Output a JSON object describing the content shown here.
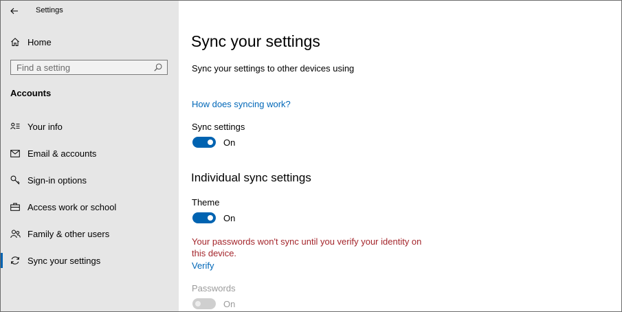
{
  "window": {
    "title": "Settings"
  },
  "sidebar": {
    "home_label": "Home",
    "search": {
      "placeholder": "Find a setting"
    },
    "section_heading": "Accounts",
    "items": [
      {
        "label": "Your info",
        "icon": "person-card-icon"
      },
      {
        "label": "Email & accounts",
        "icon": "mail-icon"
      },
      {
        "label": "Sign-in options",
        "icon": "key-icon"
      },
      {
        "label": "Access work or school",
        "icon": "briefcase-icon"
      },
      {
        "label": "Family & other users",
        "icon": "people-icon"
      },
      {
        "label": "Sync your settings",
        "icon": "sync-icon",
        "active": true
      }
    ]
  },
  "main": {
    "title": "Sync your settings",
    "subtitle": "Sync your settings to other devices using",
    "how_link": "How does syncing work?",
    "sync_settings": {
      "label": "Sync settings",
      "state": "On"
    },
    "individual_title": "Individual sync settings",
    "theme": {
      "label": "Theme",
      "state": "On"
    },
    "warning": "Your passwords won't sync until you verify your identity on this device.",
    "verify_link": "Verify",
    "passwords": {
      "label": "Passwords",
      "state": "On"
    }
  },
  "colors": {
    "accent": "#0063b1",
    "link": "#0067b8",
    "warning": "#a4262c",
    "sidebar_bg": "#e6e6e6"
  }
}
